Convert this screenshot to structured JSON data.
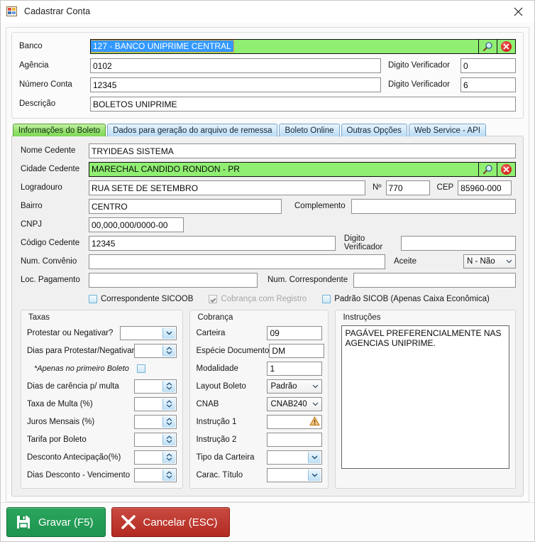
{
  "window": {
    "title": "Cadastrar Conta",
    "icon": "form-window-icon",
    "close_icon": "close-icon"
  },
  "header_fields": {
    "banco": {
      "label": "Banco",
      "value": "127 - BANCO UNIPRIME CENTRAL",
      "selected": true,
      "search_icon": "magnifier-icon",
      "clear_icon": "red-x-circle-icon"
    },
    "agencia": {
      "label": "Agência",
      "value": "0102"
    },
    "agencia_dv": {
      "label": "Digito Verificador",
      "value": "0"
    },
    "numero_conta": {
      "label": "Número Conta",
      "value": "12345"
    },
    "conta_dv": {
      "label": "Digito Verificador",
      "value": "6"
    },
    "descricao": {
      "label": "Descrição",
      "value": "BOLETOS UNIPRIME"
    }
  },
  "tabs": [
    {
      "label": "Informações do Boleto",
      "active": true
    },
    {
      "label": "Dados para geração do arquivo de remessa",
      "active": false
    },
    {
      "label": "Boleto Online",
      "active": false
    },
    {
      "label": "Outras Opções",
      "active": false
    },
    {
      "label": "Web Service - API",
      "active": false
    }
  ],
  "boleto_tab": {
    "nome_cedente": {
      "label": "Nome Cedente",
      "value": "TRYIDEAS SISTEMA"
    },
    "cidade_cedente": {
      "label": "Cidade Cedente",
      "value": "MARECHAL CANDIDO RONDON - PR",
      "search_icon": "magnifier-icon",
      "clear_icon": "red-x-circle-icon"
    },
    "logradouro": {
      "label": "Logradouro",
      "value": "RUA SETE DE SETEMBRO"
    },
    "numero": {
      "label": "Nº",
      "value": "770"
    },
    "cep": {
      "label": "CEP",
      "value": "85960-000"
    },
    "bairro": {
      "label": "Bairro",
      "value": "CENTRO"
    },
    "complemento": {
      "label": "Complemento",
      "value": ""
    },
    "cnpj": {
      "label": "CNPJ",
      "value": "00,000,000/0000-00"
    },
    "codigo_cedente": {
      "label": "Código Cedente",
      "value": "12345"
    },
    "codigo_cedente_dv": {
      "label": "Digito Verificador",
      "value": ""
    },
    "num_convenio": {
      "label": "Num. Convênio",
      "value": ""
    },
    "aceite": {
      "label": "Aceite",
      "value": "N - Não"
    },
    "loc_pagamento": {
      "label": "Loc. Pagamento",
      "value": ""
    },
    "num_correspondente": {
      "label": "Num. Correspondente",
      "value": ""
    },
    "checkboxes": [
      {
        "label": "Correspondente SICOOB",
        "checked": false,
        "disabled": false
      },
      {
        "label": "Cobrança com Registro",
        "checked": true,
        "disabled": true
      },
      {
        "label": "Padrão SICOB (Apenas Caixa Econômica)",
        "checked": false,
        "disabled": false
      }
    ]
  },
  "taxas": {
    "title": "Taxas",
    "rows": [
      {
        "label": "Protestar ou Negativar?",
        "value": "",
        "control": "combo"
      },
      {
        "label": "Dias para Protestar/Negativar",
        "value": "",
        "control": "spin"
      },
      {
        "label": "*Apenas no primeiro Boleto",
        "value": "",
        "control": "checkbox",
        "checked": false
      },
      {
        "label": "Dias de carência p/ multa",
        "value": "",
        "control": "spin"
      },
      {
        "label": "Taxa de Multa (%)",
        "value": "",
        "control": "spin"
      },
      {
        "label": "Juros Mensais (%)",
        "value": "",
        "control": "spin"
      },
      {
        "label": "Tarifa por Boleto",
        "value": "",
        "control": "spin"
      },
      {
        "label": "Desconto Antecipação(%)",
        "value": "",
        "control": "spin"
      },
      {
        "label": "Dias Desconto - Vencimento",
        "value": "",
        "control": "spin"
      }
    ]
  },
  "cobranca": {
    "title": "Cobrança",
    "rows": [
      {
        "label": "Carteira",
        "value": "09",
        "control": "text"
      },
      {
        "label": "Espécie Documento",
        "value": "DM",
        "control": "text"
      },
      {
        "label": "Modalidade",
        "value": "1",
        "control": "text"
      },
      {
        "label": "Layout Boleto",
        "value": "Padrão",
        "control": "combo-grey"
      },
      {
        "label": "CNAB",
        "value": "CNAB240",
        "control": "combo-grey"
      },
      {
        "label": "Instrução 1",
        "value": "",
        "control": "text-warn",
        "icon": "warning-triangle-icon"
      },
      {
        "label": "Instrução 2",
        "value": "",
        "control": "text"
      },
      {
        "label": "Tipo da Carteira",
        "value": "",
        "control": "combo-blue"
      },
      {
        "label": "Carac. Título",
        "value": "",
        "control": "combo-blue"
      }
    ]
  },
  "instrucoes": {
    "title": "Instruções",
    "text": "PAGÁVEL PREFERENCIALMENTE NAS AGENCIAS UNIPRIME."
  },
  "footer": {
    "save": {
      "label": "Gravar (F5)",
      "icon": "save-floppy-icon",
      "color": "#1e9450"
    },
    "cancel": {
      "label": "Cancelar (ESC)",
      "icon": "x-icon",
      "color": "#b22a22"
    }
  }
}
